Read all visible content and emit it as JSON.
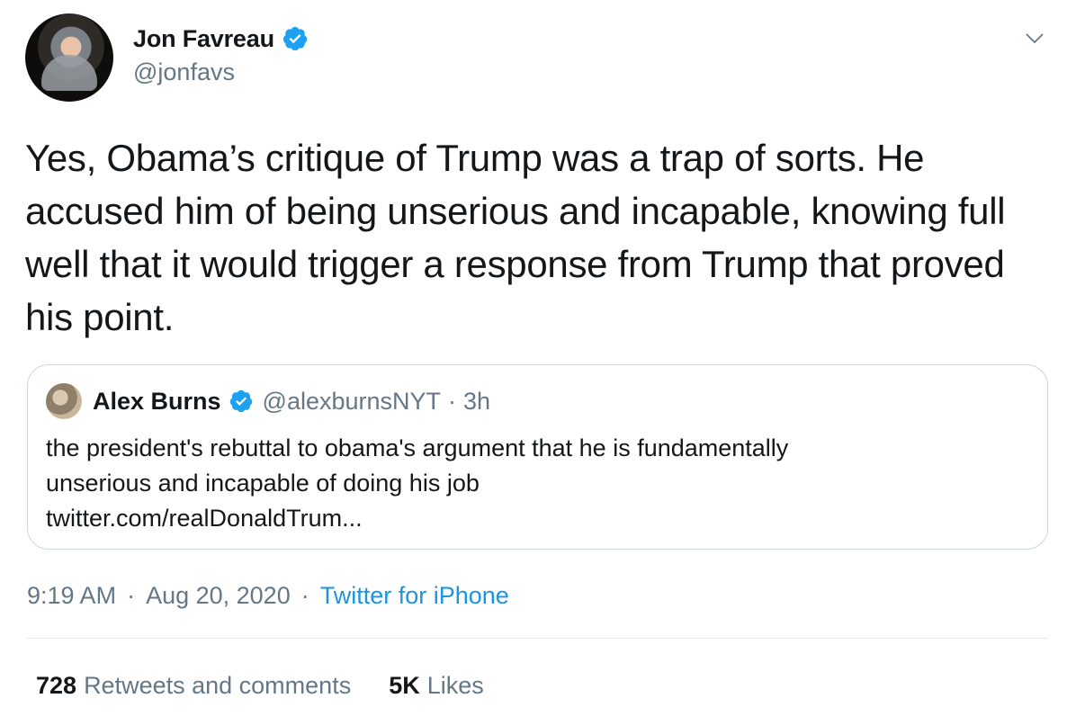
{
  "tweet": {
    "author": {
      "name": "Jon Favreau",
      "handle": "@jonfavs",
      "verified": true
    },
    "text": "Yes, Obama’s critique of Trump was a trap of sorts. He accused him of being unserious and incapable, knowing full well that it would trigger a response from Trump that proved his point.",
    "quoted": {
      "name": "Alex Burns",
      "handle": "@alexburnsNYT",
      "separator": "·",
      "time": "3h",
      "text_line1": "the president's rebuttal to obama's argument that he is fundamentally",
      "text_line2": "unserious and incapable of doing his job",
      "text_line3": "twitter.com/realDonaldTrum..."
    },
    "meta": {
      "time": "9:19 AM",
      "separator": "·",
      "date": "Aug 20, 2020",
      "source": "Twitter for iPhone"
    },
    "stats": {
      "retweets_count": "728",
      "retweets_label": "Retweets and comments",
      "likes_count": "5K",
      "likes_label": "Likes"
    }
  },
  "colors": {
    "accent": "#1da1f2",
    "link": "#1b95e0",
    "secondary_text": "#657786",
    "border": "#ccd6dd"
  },
  "icons": {
    "verified": "verified-badge-icon",
    "caret": "chevron-down-icon"
  }
}
